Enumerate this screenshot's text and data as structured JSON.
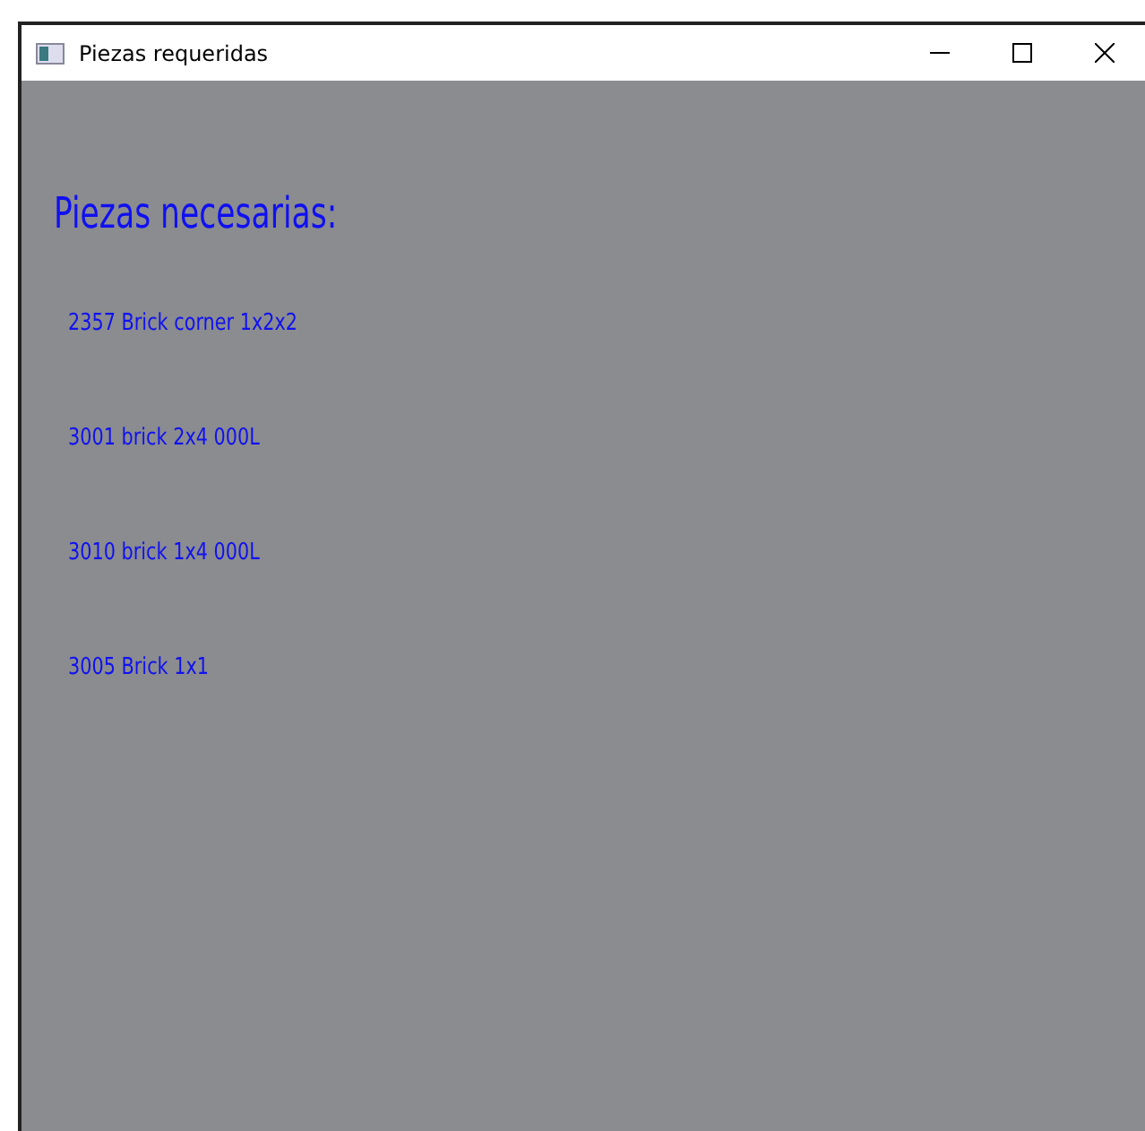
{
  "window": {
    "title": "Piezas requeridas"
  },
  "heading": "Piezas necesarias:",
  "pieces": [
    "2357 Brick corner 1x2x2",
    "3001 brick 2x4 000L",
    "3010 brick 1x4 000L",
    "3005 Brick 1x1"
  ]
}
